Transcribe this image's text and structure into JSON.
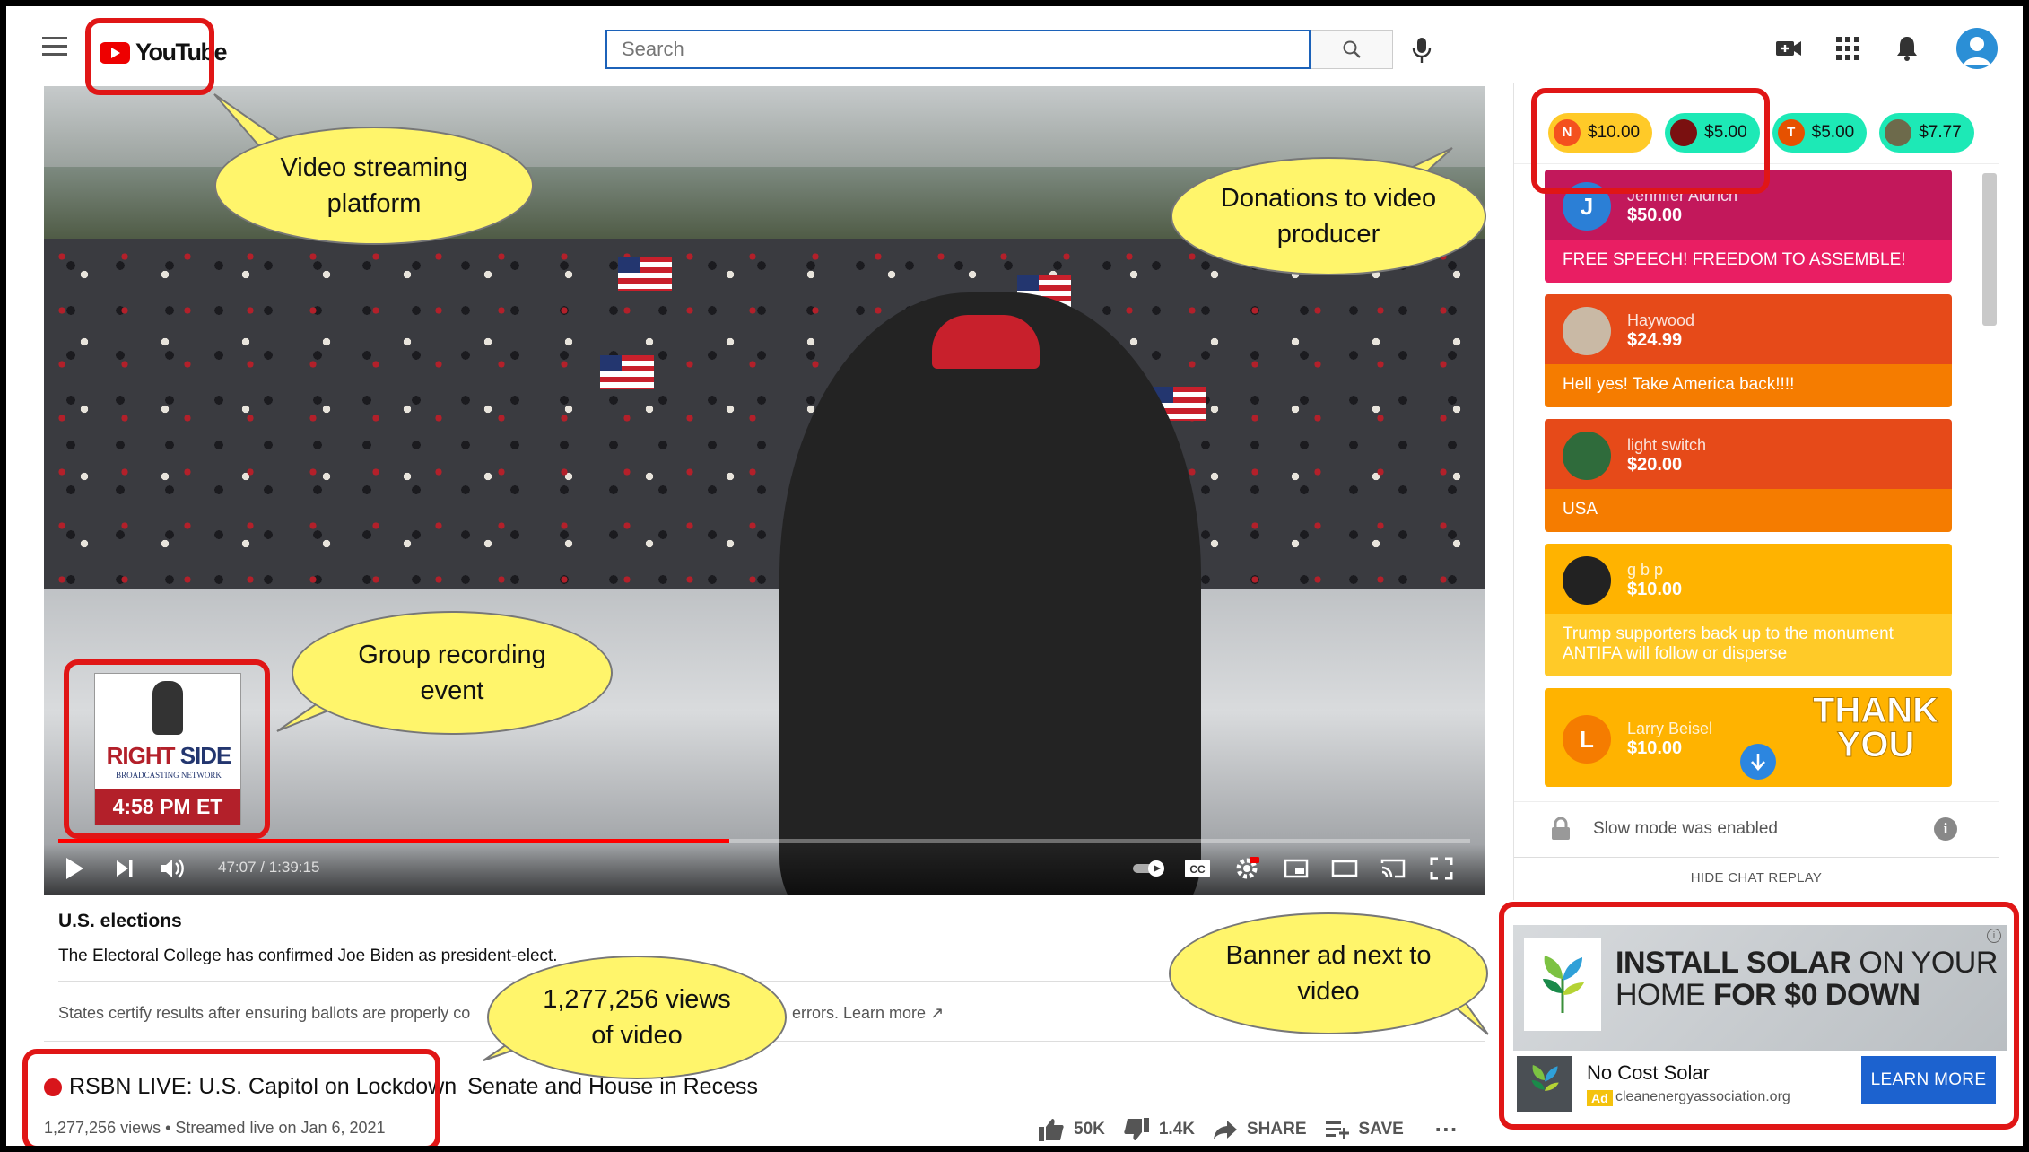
{
  "header": {
    "logo_text": "YouTube",
    "search_placeholder": "Search",
    "icons": [
      "menu-icon",
      "search-icon",
      "mic-icon",
      "create-video-icon",
      "apps-icon",
      "bell-icon",
      "avatar"
    ]
  },
  "player": {
    "time": "47:07 / 1:39:15",
    "progress": 0.475,
    "overlay": {
      "brand_red": "RIGHT",
      "brand_blue": "SIDE",
      "network": "BROADCASTING NETWORK",
      "clock": "4:58 PM ET"
    }
  },
  "info_panel": {
    "topic": "U.S. elections",
    "description": "The Electoral College has confirmed Joe Biden as president-elect.",
    "note": "States certify results after ensuring ballots are properly co",
    "note_end": "errors. Learn more"
  },
  "video": {
    "title_start": "RSBN LIVE: U.S. Capitol on Lockdown",
    "title_end": "Senate and House in Recess",
    "views": "1,277,256 views",
    "streamed": "Streamed live on Jan 6, 2021",
    "likes": "50K",
    "dislikes": "1.4K",
    "share_label": "SHARE",
    "save_label": "SAVE"
  },
  "chat": {
    "chips": [
      {
        "initial": "N",
        "amount": "$10.00",
        "bg": "#ffca28",
        "avatar_bg": "#f4511e"
      },
      {
        "initial": "",
        "amount": "$5.00",
        "bg": "#1de9b6",
        "avatar_bg": "#7a1010"
      },
      {
        "initial": "T",
        "amount": "$5.00",
        "bg": "#1de9b6",
        "avatar_bg": "#e65100"
      },
      {
        "initial": "",
        "amount": "$7.77",
        "bg": "#1de9b6",
        "avatar_bg": "#6d6a4b"
      }
    ],
    "messages": [
      {
        "initial": "J",
        "name": "Jennifer Aldrich",
        "amount": "$50.00",
        "text": "FREE SPEECH! FREEDOM TO ASSEMBLE!",
        "head_bg": "#c2185b",
        "body_bg": "#e91e63",
        "avatar_bg": "#2b7fd6"
      },
      {
        "initial": "",
        "name": "Haywood",
        "amount": "$24.99",
        "text": "Hell yes! Take America back!!!!",
        "head_bg": "#e64a19",
        "body_bg": "#f57c00",
        "avatar_bg": "#c9b9a5"
      },
      {
        "initial": "",
        "name": "light switch",
        "amount": "$20.00",
        "text": "USA",
        "head_bg": "#e64a19",
        "body_bg": "#f57c00",
        "avatar_bg": "#2f6b3b"
      },
      {
        "initial": "",
        "name": "g b p",
        "amount": "$10.00",
        "text": "Trump supporters back up to the monument ANTIFA will follow or disperse",
        "head_bg": "#ffb300",
        "body_bg": "#ffca28",
        "avatar_bg": "#222222"
      },
      {
        "initial": "L",
        "name": "Larry Beisel",
        "amount": "$10.00",
        "text": "",
        "head_bg": "#ffb300",
        "body_bg": "#ffca28",
        "avatar_bg": "#f57c00"
      }
    ],
    "thank_you": "THANK YOU",
    "slow_mode": "Slow mode was enabled",
    "hide_replay": "HIDE CHAT REPLAY"
  },
  "ad": {
    "headline_1a": "INSTALL SOLAR",
    "headline_1b": "ON YOUR",
    "headline_2a": "HOME",
    "headline_2b": "FOR $0 DOWN",
    "advertiser": "No Cost Solar",
    "badge": "Ad",
    "domain": "cleanenergyassociation.org",
    "cta": "LEARN MORE"
  },
  "annotations": {
    "platform": "Video streaming platform",
    "donations": "Donations to video producer",
    "group": "Group recording event",
    "views": "1,277,256 views of video",
    "banner": "Banner ad next to video"
  },
  "colors": {
    "annotation_red": "#e01616",
    "bubble_yellow": "#fff56b",
    "youtube_red": "#ff0000"
  }
}
